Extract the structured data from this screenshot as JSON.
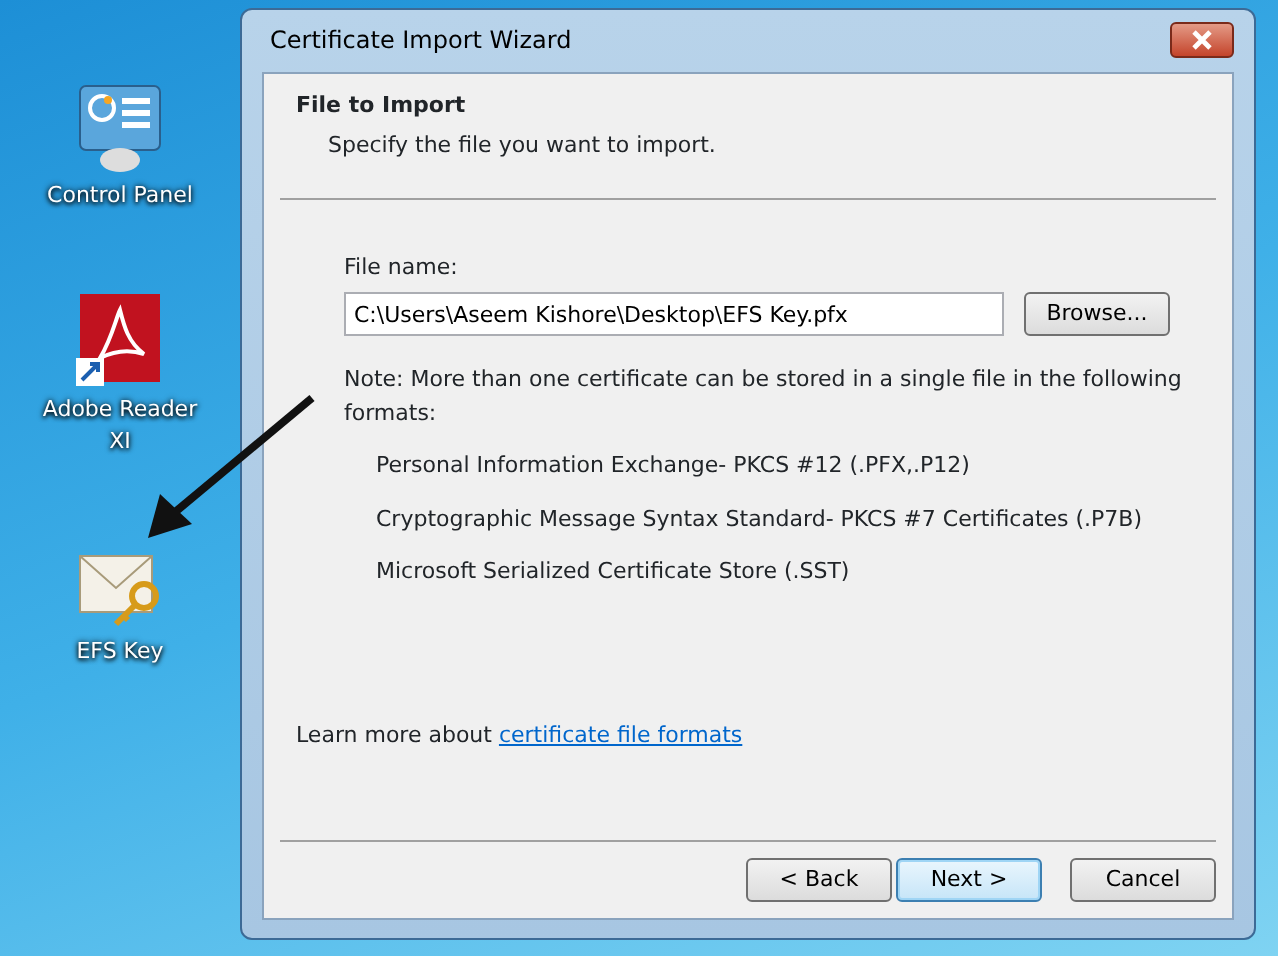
{
  "desktop_icons": [
    {
      "label": "Control Panel",
      "kind": "control-panel"
    },
    {
      "label": "Adobe Reader XI",
      "kind": "pdf"
    },
    {
      "label": "EFS Key",
      "kind": "certificate"
    }
  ],
  "window": {
    "title": "Certificate Import Wizard"
  },
  "header": {
    "title": "File to Import",
    "subtitle": "Specify the file you want to import."
  },
  "file_name": {
    "label": "File name:",
    "value": "C:\\Users\\Aseem Kishore\\Desktop\\EFS Key.pfx",
    "browse": "Browse..."
  },
  "note": "Note:  More than one certificate can be stored in a single file in the following formats:",
  "formats": [
    "Personal Information Exchange- PKCS #12 (.PFX,.P12)",
    "Cryptographic Message Syntax Standard- PKCS #7 Certificates (.P7B)",
    "Microsoft Serialized Certificate Store (.SST)"
  ],
  "learn_more": {
    "text": "Learn more about",
    "link": "certificate file formats"
  },
  "buttons": [
    {
      "label": "< Back",
      "default": false
    },
    {
      "label": "Next >",
      "default": true
    },
    {
      "label": "Cancel",
      "default": false
    }
  ]
}
